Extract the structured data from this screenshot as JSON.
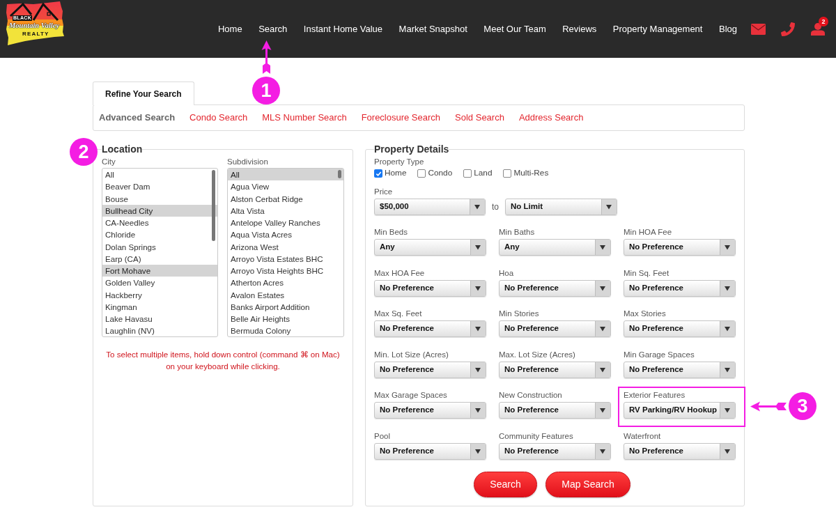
{
  "header": {
    "logo": {
      "lines": [
        "BLACK",
        "Mountain Valley",
        "REALTY"
      ]
    },
    "nav": [
      {
        "label": "Home"
      },
      {
        "label": "Search",
        "callout": "1"
      },
      {
        "label": "Instant Home Value"
      },
      {
        "label": "Market Snapshot"
      },
      {
        "label": "Meet Our Team"
      },
      {
        "label": "Reviews"
      },
      {
        "label": "Property Management"
      },
      {
        "label": "Blog"
      }
    ],
    "actions": [
      {
        "kind": "mail"
      },
      {
        "kind": "phone"
      },
      {
        "kind": "account",
        "badge": "2"
      }
    ]
  },
  "tabs": [
    {
      "label": "Refine Your Search",
      "selected": true
    }
  ],
  "search_types": [
    {
      "label": "Advanced Search",
      "selected": true
    },
    {
      "label": "Condo Search",
      "selected": false
    },
    {
      "label": "MLS Number Search",
      "selected": false
    },
    {
      "label": "Foreclosure Search",
      "selected": false
    },
    {
      "label": "Sold Search",
      "selected": false
    },
    {
      "label": "Address Search",
      "selected": false
    }
  ],
  "location": {
    "title": "Location",
    "callout": "2",
    "lists": [
      {
        "label": "City",
        "options": [
          {
            "label": "All",
            "selected": false
          },
          {
            "label": "Beaver Dam",
            "selected": false
          },
          {
            "label": "Bouse",
            "selected": false
          },
          {
            "label": "Bullhead City",
            "selected": true
          },
          {
            "label": "CA-Needles",
            "selected": false
          },
          {
            "label": "Chloride",
            "selected": false
          },
          {
            "label": "Dolan Springs",
            "selected": false
          },
          {
            "label": "Earp (CA)",
            "selected": false
          },
          {
            "label": "Fort Mohave",
            "selected": true
          },
          {
            "label": "Golden Valley",
            "selected": false
          },
          {
            "label": "Hackberry",
            "selected": false
          },
          {
            "label": "Kingman",
            "selected": false
          },
          {
            "label": "Lake Havasu",
            "selected": false
          },
          {
            "label": "Laughlin (NV)",
            "selected": false
          }
        ]
      },
      {
        "label": "Subdivision",
        "options": [
          {
            "label": "All",
            "selected": true
          },
          {
            "label": "Agua View",
            "selected": false
          },
          {
            "label": "Alston Cerbat Ridge",
            "selected": false
          },
          {
            "label": "Alta Vista",
            "selected": false
          },
          {
            "label": "Antelope Valley Ranches",
            "selected": false
          },
          {
            "label": "Aqua Vista Acres",
            "selected": false
          },
          {
            "label": "Arizona West",
            "selected": false
          },
          {
            "label": "Arroyo Vista Estates BHC",
            "selected": false
          },
          {
            "label": "Arroyo Vista Heights BHC",
            "selected": false
          },
          {
            "label": "Atherton Acres",
            "selected": false
          },
          {
            "label": "Avalon Estates",
            "selected": false
          },
          {
            "label": "Banks Airport Addition",
            "selected": false
          },
          {
            "label": "Belle Air Heights",
            "selected": false
          },
          {
            "label": "Bermuda Colony",
            "selected": false
          }
        ]
      }
    ],
    "hint": "To select multiple items, hold down control (command ⌘ on Mac) on your keyboard while clicking."
  },
  "property_details": {
    "title": "Property Details",
    "property_type": {
      "label": "Property Type",
      "options": [
        {
          "label": "Home",
          "checked": true
        },
        {
          "label": "Condo",
          "checked": false
        },
        {
          "label": "Land",
          "checked": false
        },
        {
          "label": "Multi-Res",
          "checked": false
        }
      ]
    },
    "price": {
      "label": "Price",
      "min": "$50,000",
      "separator": "to",
      "max": "No Limit"
    },
    "filters": [
      {
        "label": "Min Beds",
        "value": "Any"
      },
      {
        "label": "Min Baths",
        "value": "Any"
      },
      {
        "label": "Min HOA Fee",
        "value": "No Preference"
      },
      {
        "label": "Max HOA Fee",
        "value": "No Preference"
      },
      {
        "label": "Hoa",
        "value": "No Preference"
      },
      {
        "label": "Min Sq. Feet",
        "value": "No Preference"
      },
      {
        "label": "Max Sq. Feet",
        "value": "No Preference"
      },
      {
        "label": "Min Stories",
        "value": "No Preference"
      },
      {
        "label": "Max Stories",
        "value": "No Preference"
      },
      {
        "label": "Min. Lot Size (Acres)",
        "value": "No Preference"
      },
      {
        "label": "Max. Lot Size (Acres)",
        "value": "No Preference"
      },
      {
        "label": "Min Garage Spaces",
        "value": "No Preference"
      },
      {
        "label": "Max Garage Spaces",
        "value": "No Preference"
      },
      {
        "label": "New Construction",
        "value": "No Preference"
      },
      {
        "label": "Exterior Features",
        "value": "RV Parking/RV Hookup",
        "callout": "3"
      },
      {
        "label": "Pool",
        "value": "No Preference"
      },
      {
        "label": "Community Features",
        "value": "No Preference"
      },
      {
        "label": "Waterfront",
        "value": "No Preference"
      }
    ],
    "buttons": [
      {
        "label": "Search"
      },
      {
        "label": "Map Search"
      }
    ]
  }
}
